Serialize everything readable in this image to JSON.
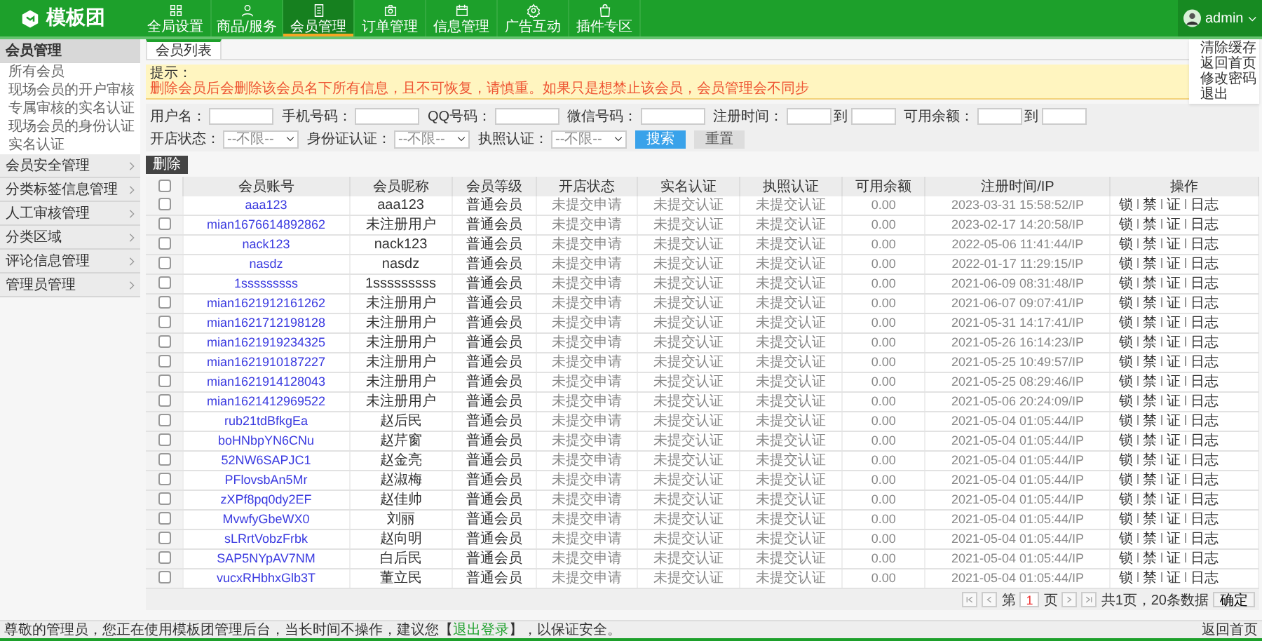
{
  "header": {
    "logo": "模板团",
    "nav": [
      {
        "label": "全局设置",
        "selected": false
      },
      {
        "label": "商品/服务",
        "selected": false
      },
      {
        "label": "会员管理",
        "selected": true
      },
      {
        "label": "订单管理",
        "selected": false
      },
      {
        "label": "信息管理",
        "selected": false
      },
      {
        "label": "广告互动",
        "selected": false
      },
      {
        "label": "插件专区",
        "selected": false
      }
    ],
    "user": {
      "name": "admin",
      "menu": [
        "清除缓存",
        "返回首页",
        "修改密码",
        "退出"
      ]
    }
  },
  "sidebar": {
    "groups": [
      {
        "label": "会员管理",
        "expanded": true,
        "items": [
          "所有会员",
          "现场会员的开户审核",
          "专属审核的实名认证",
          "现场会员的身份认证",
          "实名认证"
        ]
      },
      {
        "label": "会员安全管理",
        "expanded": false
      },
      {
        "label": "分类标签信息管理",
        "expanded": false
      },
      {
        "label": "人工审核管理",
        "expanded": false
      },
      {
        "label": "分类区域",
        "expanded": false
      },
      {
        "label": "评论信息管理",
        "expanded": false
      },
      {
        "label": "管理员管理",
        "expanded": false
      }
    ]
  },
  "tab": {
    "label": "会员列表",
    "selected": true
  },
  "notice": {
    "title": "提示：",
    "text": "删除会员后会删除该会员名下所有信息，且不可恢复，请慎重。如果只是想禁止该会员，会员管理会不同步"
  },
  "search": {
    "fields": [
      {
        "kind": "text",
        "label": "用户名："
      },
      {
        "kind": "text",
        "label": "手机号码："
      },
      {
        "kind": "text",
        "label": "QQ号码："
      },
      {
        "kind": "text",
        "label": "微信号码："
      },
      {
        "kind": "range",
        "label": "注册时间：",
        "sep": "到"
      },
      {
        "kind": "range",
        "label": "可用余额：",
        "sep": "到"
      },
      {
        "kind": "select",
        "label": "开店状态：",
        "value": "--不限--"
      },
      {
        "kind": "select",
        "label": "身份证认证：",
        "value": "--不限--"
      },
      {
        "kind": "select",
        "label": "执照认证：",
        "value": "--不限--"
      }
    ],
    "search_button": "搜索",
    "reset_button": "重置"
  },
  "delete_button": "删除",
  "table": {
    "all_checked": false,
    "columns": [
      "会员账号",
      "会员昵称",
      "会员等级",
      "开店状态",
      "实名认证",
      "执照认证",
      "可用余额",
      "注册时间/IP",
      "操作"
    ],
    "rows": [
      {
        "checked": false,
        "account": "aaa123",
        "nickname": "aaa123",
        "level": "普通会员",
        "shop": "未提交申请",
        "real_name": "未提交认证",
        "license": "未提交认证",
        "balance": "0.00",
        "time": "2023-03-31 15:58:52/IP",
        "actions": [
          "锁",
          "禁",
          "证",
          "日志"
        ]
      },
      {
        "checked": false,
        "account": "mian1676614892862",
        "nickname": "未注册用户",
        "level": "普通会员",
        "shop": "未提交申请",
        "real_name": "未提交认证",
        "license": "未提交认证",
        "balance": "0.00",
        "time": "2023-02-17 14:20:58/IP",
        "actions": [
          "锁",
          "禁",
          "证",
          "日志"
        ]
      },
      {
        "checked": false,
        "account": "nack123",
        "nickname": "nack123",
        "level": "普通会员",
        "shop": "未提交申请",
        "real_name": "未提交认证",
        "license": "未提交认证",
        "balance": "0.00",
        "time": "2022-05-06 11:41:44/IP",
        "actions": [
          "锁",
          "禁",
          "证",
          "日志"
        ]
      },
      {
        "checked": false,
        "account": "nasdz",
        "nickname": "nasdz",
        "level": "普通会员",
        "shop": "未提交申请",
        "real_name": "未提交认证",
        "license": "未提交认证",
        "balance": "0.00",
        "time": "2022-01-17 11:29:15/IP",
        "actions": [
          "锁",
          "禁",
          "证",
          "日志"
        ]
      },
      {
        "checked": false,
        "account": "1sssssssss",
        "nickname": "1sssssssss",
        "level": "普通会员",
        "shop": "未提交申请",
        "real_name": "未提交认证",
        "license": "未提交认证",
        "balance": "0.00",
        "time": "2021-06-09 08:31:48/IP",
        "actions": [
          "锁",
          "禁",
          "证",
          "日志"
        ]
      },
      {
        "checked": false,
        "account": "mian1621912161262",
        "nickname": "未注册用户",
        "level": "普通会员",
        "shop": "未提交申请",
        "real_name": "未提交认证",
        "license": "未提交认证",
        "balance": "0.00",
        "time": "2021-06-07 09:07:41/IP",
        "actions": [
          "锁",
          "禁",
          "证",
          "日志"
        ]
      },
      {
        "checked": false,
        "account": "mian1621712198128",
        "nickname": "未注册用户",
        "level": "普通会员",
        "shop": "未提交申请",
        "real_name": "未提交认证",
        "license": "未提交认证",
        "balance": "0.00",
        "time": "2021-05-31 14:17:41/IP",
        "actions": [
          "锁",
          "禁",
          "证",
          "日志"
        ]
      },
      {
        "checked": false,
        "account": "mian1621919234325",
        "nickname": "未注册用户",
        "level": "普通会员",
        "shop": "未提交申请",
        "real_name": "未提交认证",
        "license": "未提交认证",
        "balance": "0.00",
        "time": "2021-05-26 16:14:23/IP",
        "actions": [
          "锁",
          "禁",
          "证",
          "日志"
        ]
      },
      {
        "checked": false,
        "account": "mian1621910187227",
        "nickname": "未注册用户",
        "level": "普通会员",
        "shop": "未提交申请",
        "real_name": "未提交认证",
        "license": "未提交认证",
        "balance": "0.00",
        "time": "2021-05-25 10:49:57/IP",
        "actions": [
          "锁",
          "禁",
          "证",
          "日志"
        ]
      },
      {
        "checked": false,
        "account": "mian1621914128043",
        "nickname": "未注册用户",
        "level": "普通会员",
        "shop": "未提交申请",
        "real_name": "未提交认证",
        "license": "未提交认证",
        "balance": "0.00",
        "time": "2021-05-25 08:29:46/IP",
        "actions": [
          "锁",
          "禁",
          "证",
          "日志"
        ]
      },
      {
        "checked": false,
        "account": "mian1621412969522",
        "nickname": "未注册用户",
        "level": "普通会员",
        "shop": "未提交申请",
        "real_name": "未提交认证",
        "license": "未提交认证",
        "balance": "0.00",
        "time": "2021-05-06 20:24:09/IP",
        "actions": [
          "锁",
          "禁",
          "证",
          "日志"
        ]
      },
      {
        "checked": false,
        "account": "rub21tdBfkgEa",
        "nickname": "赵后民",
        "level": "普通会员",
        "shop": "未提交申请",
        "real_name": "未提交认证",
        "license": "未提交认证",
        "balance": "0.00",
        "time": "2021-05-04 01:05:44/IP",
        "actions": [
          "锁",
          "禁",
          "证",
          "日志"
        ]
      },
      {
        "checked": false,
        "account": "boHNbpYN6CNu",
        "nickname": "赵芹窗",
        "level": "普通会员",
        "shop": "未提交申请",
        "real_name": "未提交认证",
        "license": "未提交认证",
        "balance": "0.00",
        "time": "2021-05-04 01:05:44/IP",
        "actions": [
          "锁",
          "禁",
          "证",
          "日志"
        ]
      },
      {
        "checked": false,
        "account": "52NW6SAPJC1",
        "nickname": "赵金亮",
        "level": "普通会员",
        "shop": "未提交申请",
        "real_name": "未提交认证",
        "license": "未提交认证",
        "balance": "0.00",
        "time": "2021-05-04 01:05:44/IP",
        "actions": [
          "锁",
          "禁",
          "证",
          "日志"
        ]
      },
      {
        "checked": false,
        "account": "PFlovsbAn5Mr",
        "nickname": "赵淑梅",
        "level": "普通会员",
        "shop": "未提交申请",
        "real_name": "未提交认证",
        "license": "未提交认证",
        "balance": "0.00",
        "time": "2021-05-04 01:05:44/IP",
        "actions": [
          "锁",
          "禁",
          "证",
          "日志"
        ]
      },
      {
        "checked": false,
        "account": "zXPf8pq0dy2EF",
        "nickname": "赵佳帅",
        "level": "普通会员",
        "shop": "未提交申请",
        "real_name": "未提交认证",
        "license": "未提交认证",
        "balance": "0.00",
        "time": "2021-05-04 01:05:44/IP",
        "actions": [
          "锁",
          "禁",
          "证",
          "日志"
        ]
      },
      {
        "checked": false,
        "account": "MvwfyGbeWX0",
        "nickname": "刘丽",
        "level": "普通会员",
        "shop": "未提交申请",
        "real_name": "未提交认证",
        "license": "未提交认证",
        "balance": "0.00",
        "time": "2021-05-04 01:05:44/IP",
        "actions": [
          "锁",
          "禁",
          "证",
          "日志"
        ]
      },
      {
        "checked": false,
        "account": "sLRrtVobzFrbk",
        "nickname": "赵向明",
        "level": "普通会员",
        "shop": "未提交申请",
        "real_name": "未提交认证",
        "license": "未提交认证",
        "balance": "0.00",
        "time": "2021-05-04 01:05:44/IP",
        "actions": [
          "锁",
          "禁",
          "证",
          "日志"
        ]
      },
      {
        "checked": false,
        "account": "SAP5NYpAV7NM",
        "nickname": "白后民",
        "level": "普通会员",
        "shop": "未提交申请",
        "real_name": "未提交认证",
        "license": "未提交认证",
        "balance": "0.00",
        "time": "2021-05-04 01:05:44/IP",
        "actions": [
          "锁",
          "禁",
          "证",
          "日志"
        ]
      },
      {
        "checked": false,
        "account": "vucxRHbhxGlb3T",
        "nickname": "董立民",
        "level": "普通会员",
        "shop": "未提交申请",
        "real_name": "未提交认证",
        "license": "未提交认证",
        "balance": "0.00",
        "time": "2021-05-04 01:05:44/IP",
        "actions": [
          "锁",
          "禁",
          "证",
          "日志"
        ]
      }
    ]
  },
  "pagination": {
    "before": "第",
    "page": "1",
    "after": "页",
    "summary": "共1页，20条数据",
    "go_button": "确定"
  },
  "footer": {
    "message_start": "尊敬的管理员，您正在使用模板团管理后台，当长时间不操作，建议您【",
    "logout_link": "退出登录",
    "message_end": "】，以保证安全。",
    "home_link": "返回首页"
  }
}
